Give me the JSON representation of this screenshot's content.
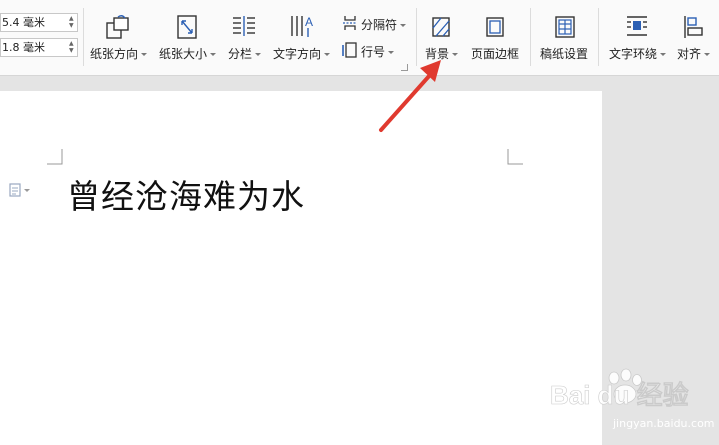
{
  "margins": {
    "top_value": "5.4 毫米",
    "bottom_value": "1.8 毫米"
  },
  "tools": {
    "orientation": "纸张方向",
    "size": "纸张大小",
    "columns": "分栏",
    "text_direction": "文字方向",
    "breaks": "分隔符",
    "line_numbers": "行号",
    "background": "背景",
    "page_border": "页面边框",
    "manuscript": "稿纸设置",
    "text_wrap": "文字环绕",
    "align": "对齐"
  },
  "document": {
    "text": "曾经沧海难为水"
  },
  "watermark": {
    "logo": "Bai du 经验",
    "url": "jingyan.baidu.com"
  },
  "colors": {
    "accent": "#2b5fb4",
    "arrow": "#e03a2f",
    "page": "#ffffff",
    "workspace": "#e4e4e4"
  }
}
